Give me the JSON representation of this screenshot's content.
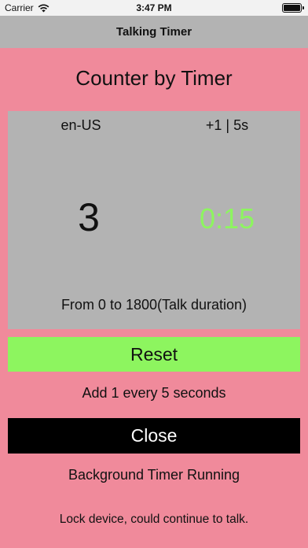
{
  "status_bar": {
    "carrier": "Carrier",
    "time": "3:47 PM"
  },
  "nav": {
    "title": "Talking Timer"
  },
  "screen": {
    "title": "Counter by Timer"
  },
  "panel": {
    "locale": "en-US",
    "rate": "+1 | 5s",
    "count": "3",
    "elapsed": "0:15",
    "range": "From 0 to 1800(Talk duration)"
  },
  "buttons": {
    "reset_label": "Reset",
    "close_label": "Close"
  },
  "info": {
    "add_text": "Add 1 every 5 seconds",
    "background_status": "Background Timer Running",
    "lock_hint": "Lock device, could continue to talk."
  },
  "colors": {
    "background": "#f08a9b",
    "panel": "#b3b3b3",
    "accent_green": "#8df55f",
    "close_button": "#000000"
  },
  "icons": {
    "wifi": "wifi-icon",
    "battery": "battery-icon"
  }
}
